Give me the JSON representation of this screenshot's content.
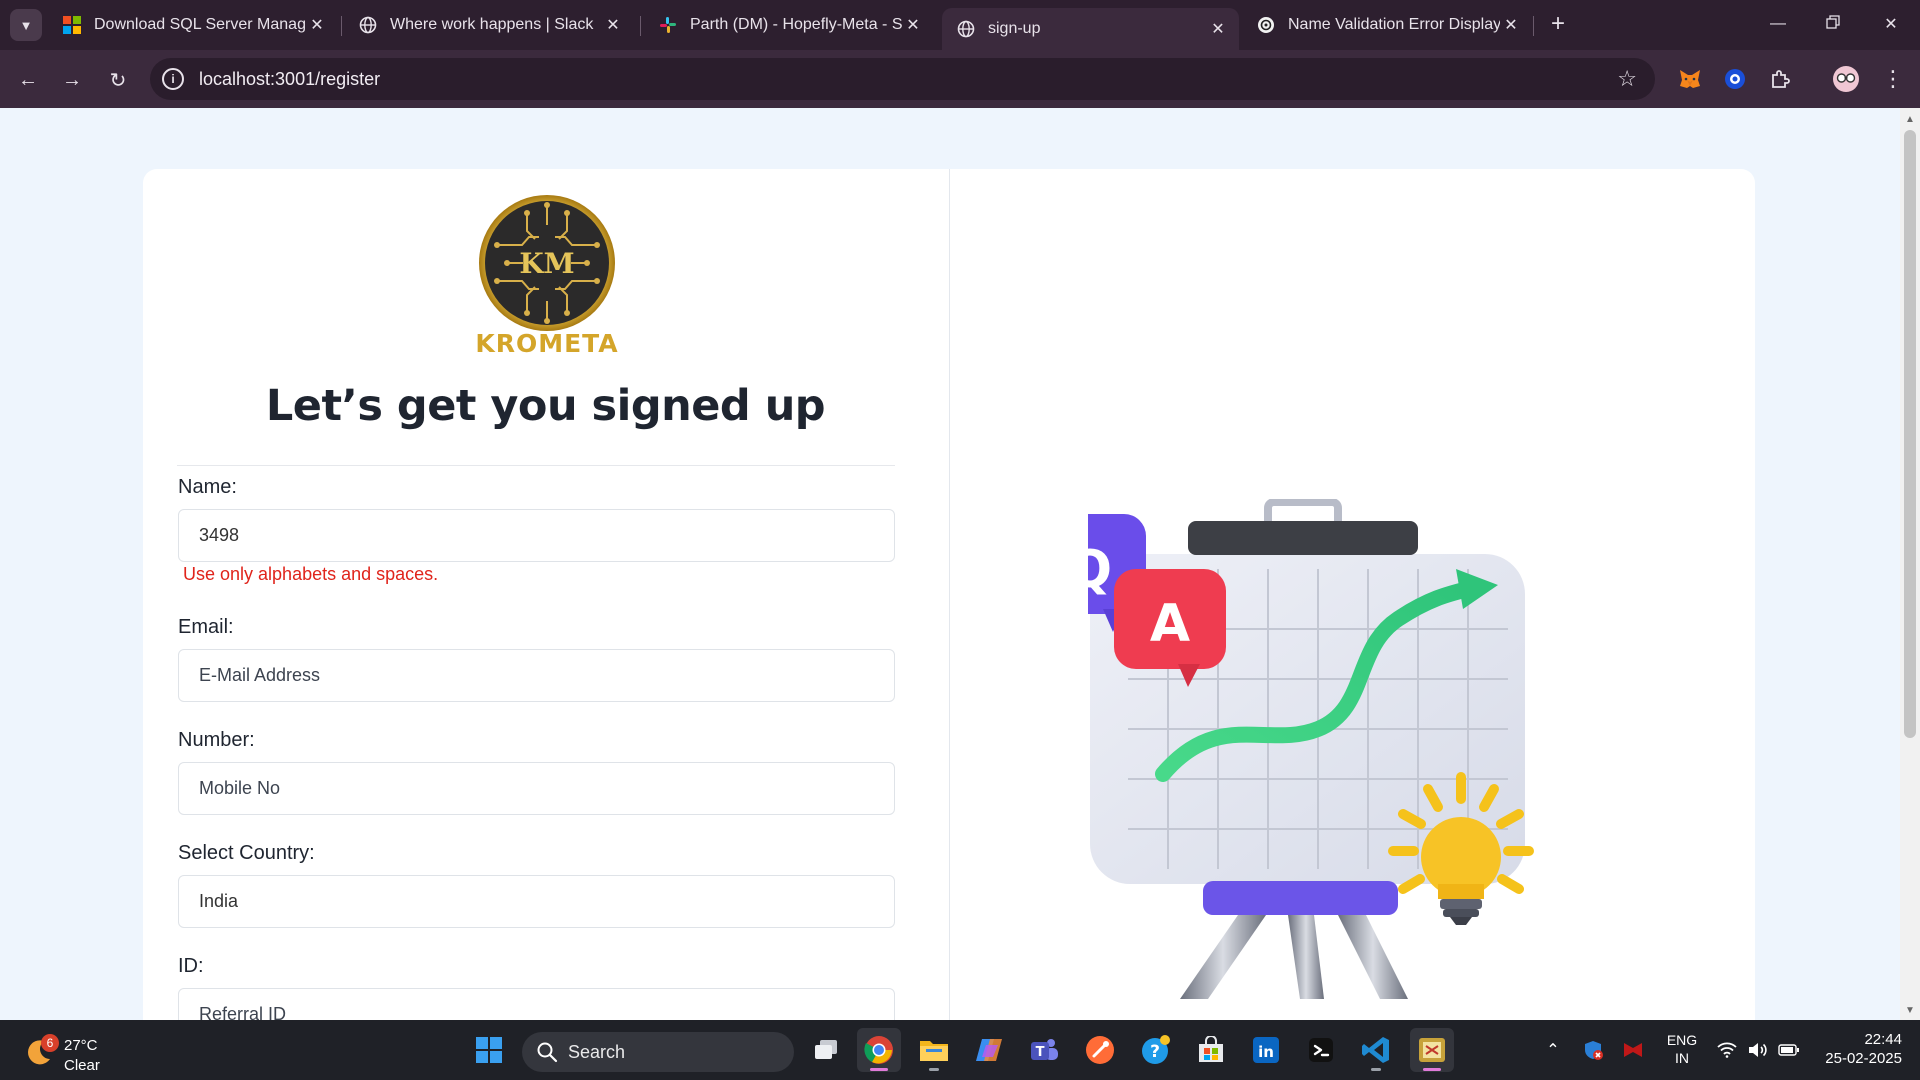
{
  "browser": {
    "tabs": [
      {
        "title": "Download SQL Server Managem",
        "icon": "microsoft-icon"
      },
      {
        "title": "Where work happens | Slack",
        "icon": "globe-icon"
      },
      {
        "title": "Parth (DM) - Hopefly-Meta - Sla",
        "icon": "slack-icon"
      },
      {
        "title": "sign-up",
        "icon": "globe-icon"
      },
      {
        "title": "Name Validation Error Display",
        "icon": "chatgpt-icon"
      }
    ],
    "active_tab": 3,
    "url": "localhost:3001/register"
  },
  "page": {
    "brand": "KROMETA",
    "logo_initials": "KM",
    "headline": "Let’s get you signed up",
    "form": {
      "name_label": "Name:",
      "name_value": "3498",
      "name_error": "Use only alphabets and spaces.",
      "email_label": "Email:",
      "email_placeholder": "E-Mail Address",
      "number_label": "Number:",
      "number_placeholder": "Mobile No",
      "country_label": "Select Country:",
      "country_value": "India",
      "id_label": "ID:",
      "id_placeholder": "Referral ID"
    },
    "illustration": {
      "q_letter": "Q",
      "a_letter": "A"
    }
  },
  "taskbar": {
    "weather": {
      "temp": "27°C",
      "condition": "Clear",
      "badge": "6"
    },
    "search_label": "Search",
    "apps": [
      "start-icon",
      "task-view-icon",
      "chrome-icon",
      "file-explorer-icon",
      "copilot-icon",
      "teams-icon",
      "postman-icon",
      "help-icon",
      "store-icon",
      "linkedin-icon",
      "terminal-icon",
      "vscode-icon",
      "app-icon"
    ],
    "lang": {
      "line1": "ENG",
      "line2": "IN"
    },
    "time": "22:44",
    "date": "25-02-2025"
  },
  "colors": {
    "accent_gold": "#d4a52a",
    "error_red": "#e0241b",
    "page_bg": "#eef5fd",
    "chrome_bg": "#3b2a3d"
  }
}
